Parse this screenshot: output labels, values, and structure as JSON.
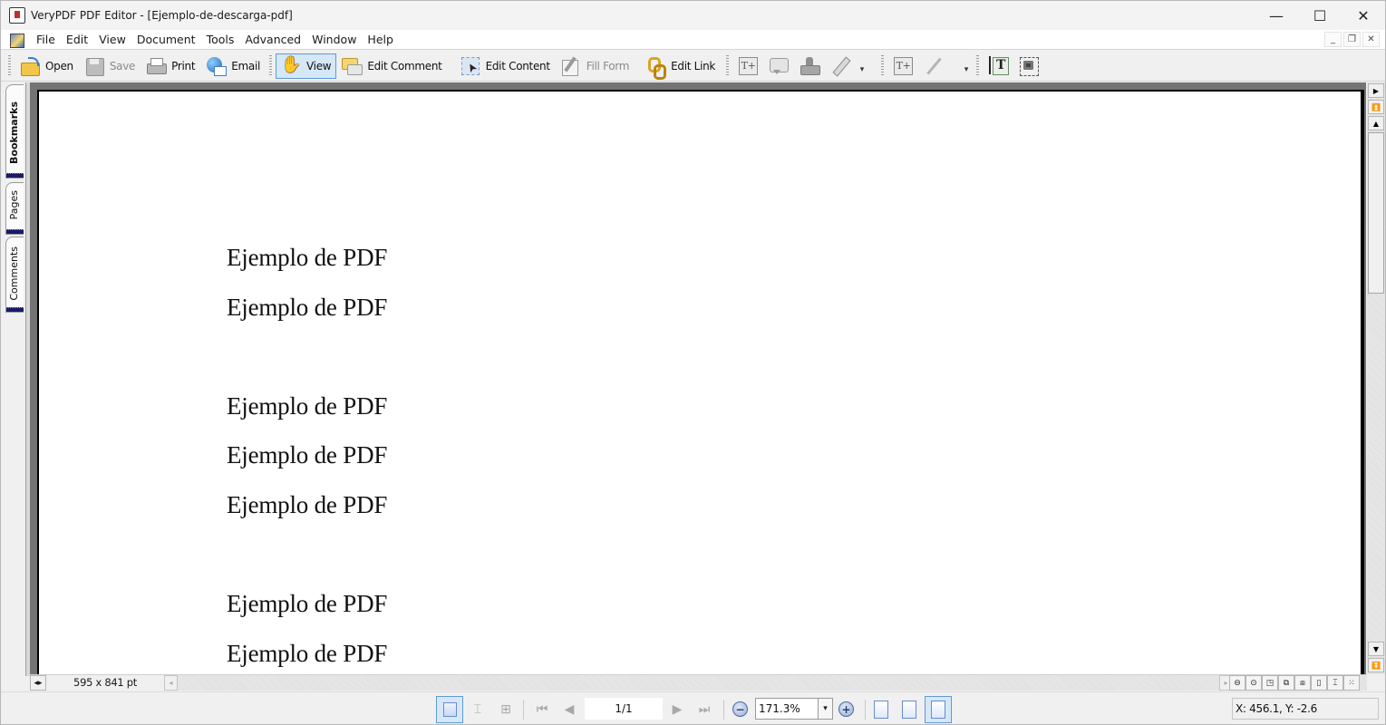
{
  "window": {
    "title": "VeryPDF PDF Editor - [Ejemplo-de-descarga-pdf]",
    "controls": {
      "minimize": "—",
      "maximize": "☐",
      "close": "✕"
    }
  },
  "menubar": {
    "items": [
      "File",
      "Edit",
      "View",
      "Document",
      "Tools",
      "Advanced",
      "Window",
      "Help"
    ],
    "mdi_controls": {
      "minimize": "_",
      "restore": "❐",
      "close": "✕"
    }
  },
  "toolbar": {
    "open": "Open",
    "save": "Save",
    "print": "Print",
    "email": "Email",
    "view": "View",
    "edit_comment": "Edit Comment",
    "edit_content": "Edit Content",
    "fill_form": "Fill Form",
    "edit_link": "Edit Link",
    "dropdown_glyph": "▾"
  },
  "sidetabs": {
    "bookmarks": "Bookmarks",
    "pages": "Pages",
    "comments": "Comments"
  },
  "document": {
    "lines": [
      "Ejemplo de PDF",
      "Ejemplo de PDF",
      "Ejemplo de PDF",
      "Ejemplo de PDF",
      "Ejemplo de PDF",
      "Ejemplo de PDF",
      "Ejemplo de PDF"
    ]
  },
  "scrollbar": {
    "right_arrow": "▶",
    "first": "⏫",
    "up": "▲",
    "down": "▼",
    "last": "⏬"
  },
  "statusstrip": {
    "page_size": "595 x 841 pt",
    "split_glyph": "◂▸",
    "left_glyph": "◂",
    "right_glyph": "▸",
    "view_modes": [
      "⊖",
      "⊙",
      "◳",
      "⧉",
      "⧈",
      "▯",
      "⌶",
      "⁙"
    ]
  },
  "navbar": {
    "page_value": "1/1",
    "zoom_value": "171.3%",
    "zoom_dropdown": "▾",
    "zoom_out": "−",
    "zoom_in": "+",
    "first": "⏮",
    "prev": "◀",
    "next": "▶",
    "last": "⏭",
    "coordinates": "X: 456.1, Y: -2.6"
  }
}
